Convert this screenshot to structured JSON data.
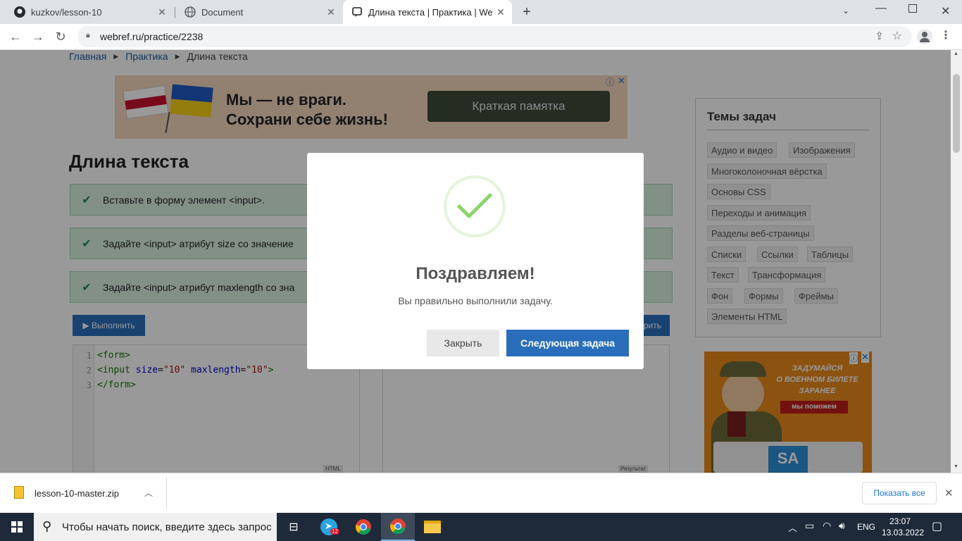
{
  "tabs": [
    {
      "title": "kuzkov/lesson-10",
      "icon": "github-icon"
    },
    {
      "title": "Document",
      "icon": "globe-icon"
    },
    {
      "title": "Длина текста | Практика | WebR",
      "icon": "webref-icon",
      "active": true
    }
  ],
  "omnibox": {
    "url": "webref.ru/practice/2238"
  },
  "breadcrumb": [
    "Главная",
    "Практика",
    "Длина текста"
  ],
  "ad_banner": {
    "line1": "Мы — не враги.",
    "line2": "Сохрани себе жизнь!",
    "button": "Краткая памятка"
  },
  "page_title": "Длина текста",
  "tasks": [
    "Вставьте в форму элемент <input>.",
    "Задайте <input> атрибут size со значение",
    "Задайте <input> атрибут maxlength со зна"
  ],
  "run_button": "▶ Выполнить",
  "check_button_partial": "рить",
  "code": {
    "line_numbers": [
      "1",
      "2",
      "3"
    ],
    "line1": "<form>",
    "line2_tag": "<input",
    "line2_attr1": "size",
    "line2_eq1": "=",
    "line2_val1": "\"10\"",
    "line2_attr2": "maxlength",
    "line2_eq2": "=",
    "line2_val2": "\"10\"",
    "line2_end": ">",
    "line3": "</form>",
    "html_label": "HTML",
    "result_label": "Результат"
  },
  "sidebar": {
    "title": "Темы задач",
    "chips": [
      "Аудио и видео",
      "Изображения",
      "Многоколоночная вёрстка",
      "Основы CSS",
      "Переходы и анимация",
      "Разделы веб-страницы",
      "Списки",
      "Ссылки",
      "Таблицы",
      "Текст",
      "Трансформация",
      "Фон",
      "Формы",
      "Фреймы",
      "Элементы HTML"
    ]
  },
  "ad2": {
    "line1": "ЗАДУМАЙСЯ",
    "line2": "О ВОЕННОМ БИЛЕТЕ",
    "line3": "ЗАРАНЕЕ",
    "line4": "мы поможем",
    "logo": "SA"
  },
  "modal": {
    "title": "Поздравляем!",
    "text": "Вы правильно выполнили задачу.",
    "close_button": "Закрыть",
    "next_button": "Следующая задача"
  },
  "download": {
    "file": "lesson-10-master.zip",
    "show_all": "Показать все"
  },
  "taskbar": {
    "search_placeholder": "Чтобы начать поиск, введите здесь запрос",
    "telegram_badge": "12",
    "lang": "ENG",
    "time": "23:07",
    "date": "13.03.2022"
  }
}
